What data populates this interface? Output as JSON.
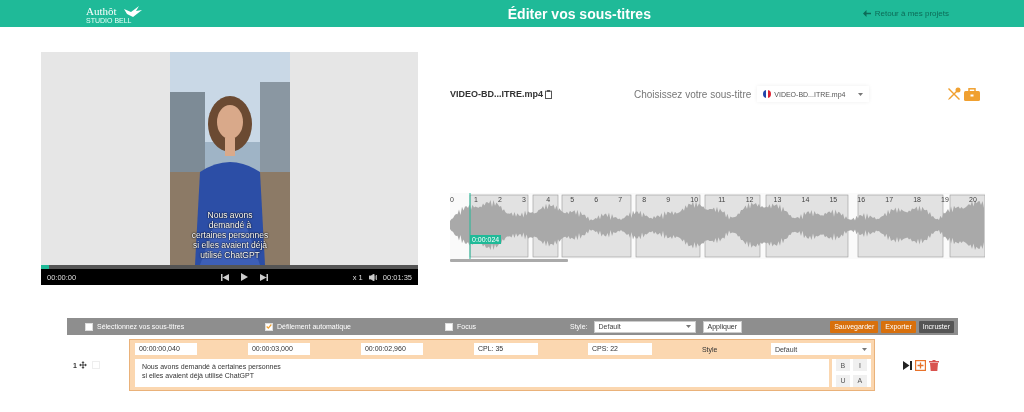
{
  "header": {
    "logo": "Authôt",
    "logo_sub": "STUDIO BELL",
    "title": "Éditer vos sous-titres",
    "back_link": "Retour à mes projets"
  },
  "player": {
    "caption": "Nous avons demandé à certaines personnes si elles avaient déjà utilisé ChatGPT",
    "current_time": "00:00:00",
    "duration": "00:01:35",
    "speed": "x 1",
    "level": 0.02
  },
  "file": {
    "name": "VIDEO-BD...ITRE.mp4",
    "choose_label": "Choisissez votre sous-titre",
    "subtitle_select": "VIDEO-BD...ITRE.mp4"
  },
  "waveform": {
    "cursor_time": "0:00:024",
    "markers": [
      "0",
      "1",
      "2",
      "3",
      "4",
      "5",
      "6",
      "7",
      "8",
      "9",
      "10",
      "11",
      "12",
      "13",
      "14",
      "15",
      "16",
      "17",
      "18",
      "19",
      "20"
    ]
  },
  "toolbar": {
    "options": [
      {
        "label": "Sélectionnez vos sous-titres",
        "checked": false
      },
      {
        "label": "Défilement automatique",
        "checked": true
      },
      {
        "label": "Focus",
        "checked": false
      }
    ],
    "style_label": "Style:",
    "style_value": "Default",
    "apply": "Appliquer",
    "actions": [
      {
        "label": "Sauvegarder",
        "kind": "primary"
      },
      {
        "label": "Exporter",
        "kind": "primary"
      },
      {
        "label": "Incruster",
        "kind": "secondary"
      }
    ]
  },
  "subtitles": [
    {
      "index": "1",
      "checked": false,
      "start": "00:00:00,040",
      "end": "00:00:03,000",
      "duration": "00:00:02,960",
      "cpl": "CPL: 35",
      "cps": "CPS: 22",
      "style_label": "Style",
      "style": "Default",
      "lines": [
        "Nous avons demandé à certaines personnes",
        "si elles avaient déjà utilisé ChatGPT"
      ],
      "format_buttons": [
        "B",
        "I",
        "U",
        "A"
      ]
    }
  ]
}
